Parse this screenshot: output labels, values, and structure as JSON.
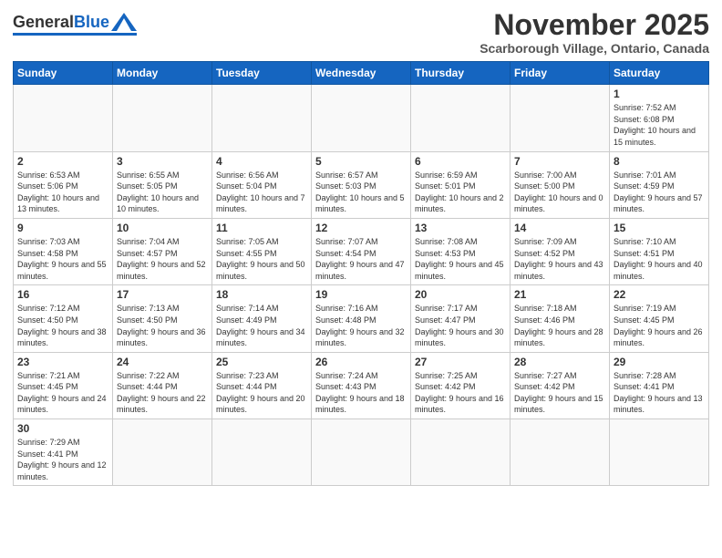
{
  "logo": {
    "general": "General",
    "blue": "Blue"
  },
  "header": {
    "month": "November 2025",
    "location": "Scarborough Village, Ontario, Canada"
  },
  "weekdays": [
    "Sunday",
    "Monday",
    "Tuesday",
    "Wednesday",
    "Thursday",
    "Friday",
    "Saturday"
  ],
  "weeks": [
    [
      {
        "day": "",
        "info": ""
      },
      {
        "day": "",
        "info": ""
      },
      {
        "day": "",
        "info": ""
      },
      {
        "day": "",
        "info": ""
      },
      {
        "day": "",
        "info": ""
      },
      {
        "day": "",
        "info": ""
      },
      {
        "day": "1",
        "info": "Sunrise: 7:52 AM\nSunset: 6:08 PM\nDaylight: 10 hours and 15 minutes."
      }
    ],
    [
      {
        "day": "2",
        "info": "Sunrise: 6:53 AM\nSunset: 5:06 PM\nDaylight: 10 hours and 13 minutes."
      },
      {
        "day": "3",
        "info": "Sunrise: 6:55 AM\nSunset: 5:05 PM\nDaylight: 10 hours and 10 minutes."
      },
      {
        "day": "4",
        "info": "Sunrise: 6:56 AM\nSunset: 5:04 PM\nDaylight: 10 hours and 7 minutes."
      },
      {
        "day": "5",
        "info": "Sunrise: 6:57 AM\nSunset: 5:03 PM\nDaylight: 10 hours and 5 minutes."
      },
      {
        "day": "6",
        "info": "Sunrise: 6:59 AM\nSunset: 5:01 PM\nDaylight: 10 hours and 2 minutes."
      },
      {
        "day": "7",
        "info": "Sunrise: 7:00 AM\nSunset: 5:00 PM\nDaylight: 10 hours and 0 minutes."
      },
      {
        "day": "8",
        "info": "Sunrise: 7:01 AM\nSunset: 4:59 PM\nDaylight: 9 hours and 57 minutes."
      }
    ],
    [
      {
        "day": "9",
        "info": "Sunrise: 7:03 AM\nSunset: 4:58 PM\nDaylight: 9 hours and 55 minutes."
      },
      {
        "day": "10",
        "info": "Sunrise: 7:04 AM\nSunset: 4:57 PM\nDaylight: 9 hours and 52 minutes."
      },
      {
        "day": "11",
        "info": "Sunrise: 7:05 AM\nSunset: 4:55 PM\nDaylight: 9 hours and 50 minutes."
      },
      {
        "day": "12",
        "info": "Sunrise: 7:07 AM\nSunset: 4:54 PM\nDaylight: 9 hours and 47 minutes."
      },
      {
        "day": "13",
        "info": "Sunrise: 7:08 AM\nSunset: 4:53 PM\nDaylight: 9 hours and 45 minutes."
      },
      {
        "day": "14",
        "info": "Sunrise: 7:09 AM\nSunset: 4:52 PM\nDaylight: 9 hours and 43 minutes."
      },
      {
        "day": "15",
        "info": "Sunrise: 7:10 AM\nSunset: 4:51 PM\nDaylight: 9 hours and 40 minutes."
      }
    ],
    [
      {
        "day": "16",
        "info": "Sunrise: 7:12 AM\nSunset: 4:50 PM\nDaylight: 9 hours and 38 minutes."
      },
      {
        "day": "17",
        "info": "Sunrise: 7:13 AM\nSunset: 4:50 PM\nDaylight: 9 hours and 36 minutes."
      },
      {
        "day": "18",
        "info": "Sunrise: 7:14 AM\nSunset: 4:49 PM\nDaylight: 9 hours and 34 minutes."
      },
      {
        "day": "19",
        "info": "Sunrise: 7:16 AM\nSunset: 4:48 PM\nDaylight: 9 hours and 32 minutes."
      },
      {
        "day": "20",
        "info": "Sunrise: 7:17 AM\nSunset: 4:47 PM\nDaylight: 9 hours and 30 minutes."
      },
      {
        "day": "21",
        "info": "Sunrise: 7:18 AM\nSunset: 4:46 PM\nDaylight: 9 hours and 28 minutes."
      },
      {
        "day": "22",
        "info": "Sunrise: 7:19 AM\nSunset: 4:45 PM\nDaylight: 9 hours and 26 minutes."
      }
    ],
    [
      {
        "day": "23",
        "info": "Sunrise: 7:21 AM\nSunset: 4:45 PM\nDaylight: 9 hours and 24 minutes."
      },
      {
        "day": "24",
        "info": "Sunrise: 7:22 AM\nSunset: 4:44 PM\nDaylight: 9 hours and 22 minutes."
      },
      {
        "day": "25",
        "info": "Sunrise: 7:23 AM\nSunset: 4:44 PM\nDaylight: 9 hours and 20 minutes."
      },
      {
        "day": "26",
        "info": "Sunrise: 7:24 AM\nSunset: 4:43 PM\nDaylight: 9 hours and 18 minutes."
      },
      {
        "day": "27",
        "info": "Sunrise: 7:25 AM\nSunset: 4:42 PM\nDaylight: 9 hours and 16 minutes."
      },
      {
        "day": "28",
        "info": "Sunrise: 7:27 AM\nSunset: 4:42 PM\nDaylight: 9 hours and 15 minutes."
      },
      {
        "day": "29",
        "info": "Sunrise: 7:28 AM\nSunset: 4:41 PM\nDaylight: 9 hours and 13 minutes."
      }
    ],
    [
      {
        "day": "30",
        "info": "Sunrise: 7:29 AM\nSunset: 4:41 PM\nDaylight: 9 hours and 12 minutes."
      },
      {
        "day": "",
        "info": ""
      },
      {
        "day": "",
        "info": ""
      },
      {
        "day": "",
        "info": ""
      },
      {
        "day": "",
        "info": ""
      },
      {
        "day": "",
        "info": ""
      },
      {
        "day": "",
        "info": ""
      }
    ]
  ]
}
